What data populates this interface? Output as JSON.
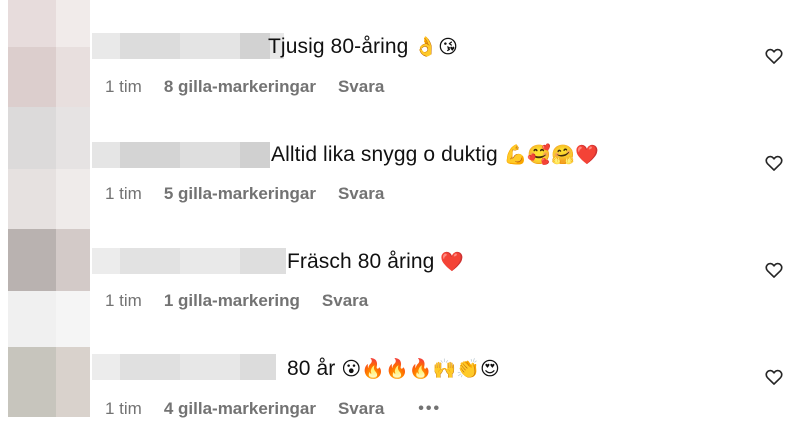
{
  "comments": [
    {
      "text": "Tjusig 80-åring",
      "emojis": "👌😘",
      "time": "1 tim",
      "likes": "8 gilla-markeringar",
      "reply": "Svara",
      "more": ""
    },
    {
      "text": "Alltid lika snygg o duktig",
      "emojis": "💪🥰🤗❤️",
      "time": "1 tim",
      "likes": "5 gilla-markeringar",
      "reply": "Svara",
      "more": ""
    },
    {
      "text": "Fräsch 80 åring",
      "emojis": "❤️",
      "time": "1 tim",
      "likes": "1 gilla-markering",
      "reply": "Svara",
      "more": ""
    },
    {
      "text": "80 år",
      "emojis": "😮🔥🔥🔥🙌👏😍",
      "time": "1 tim",
      "likes": "4 gilla-markeringar",
      "reply": "Svara",
      "more": "•••"
    }
  ],
  "icons": {
    "like": "heart-outline-icon",
    "more": "more-options-icon"
  },
  "colors": {
    "meta": "#737373",
    "heart": "#262626"
  }
}
